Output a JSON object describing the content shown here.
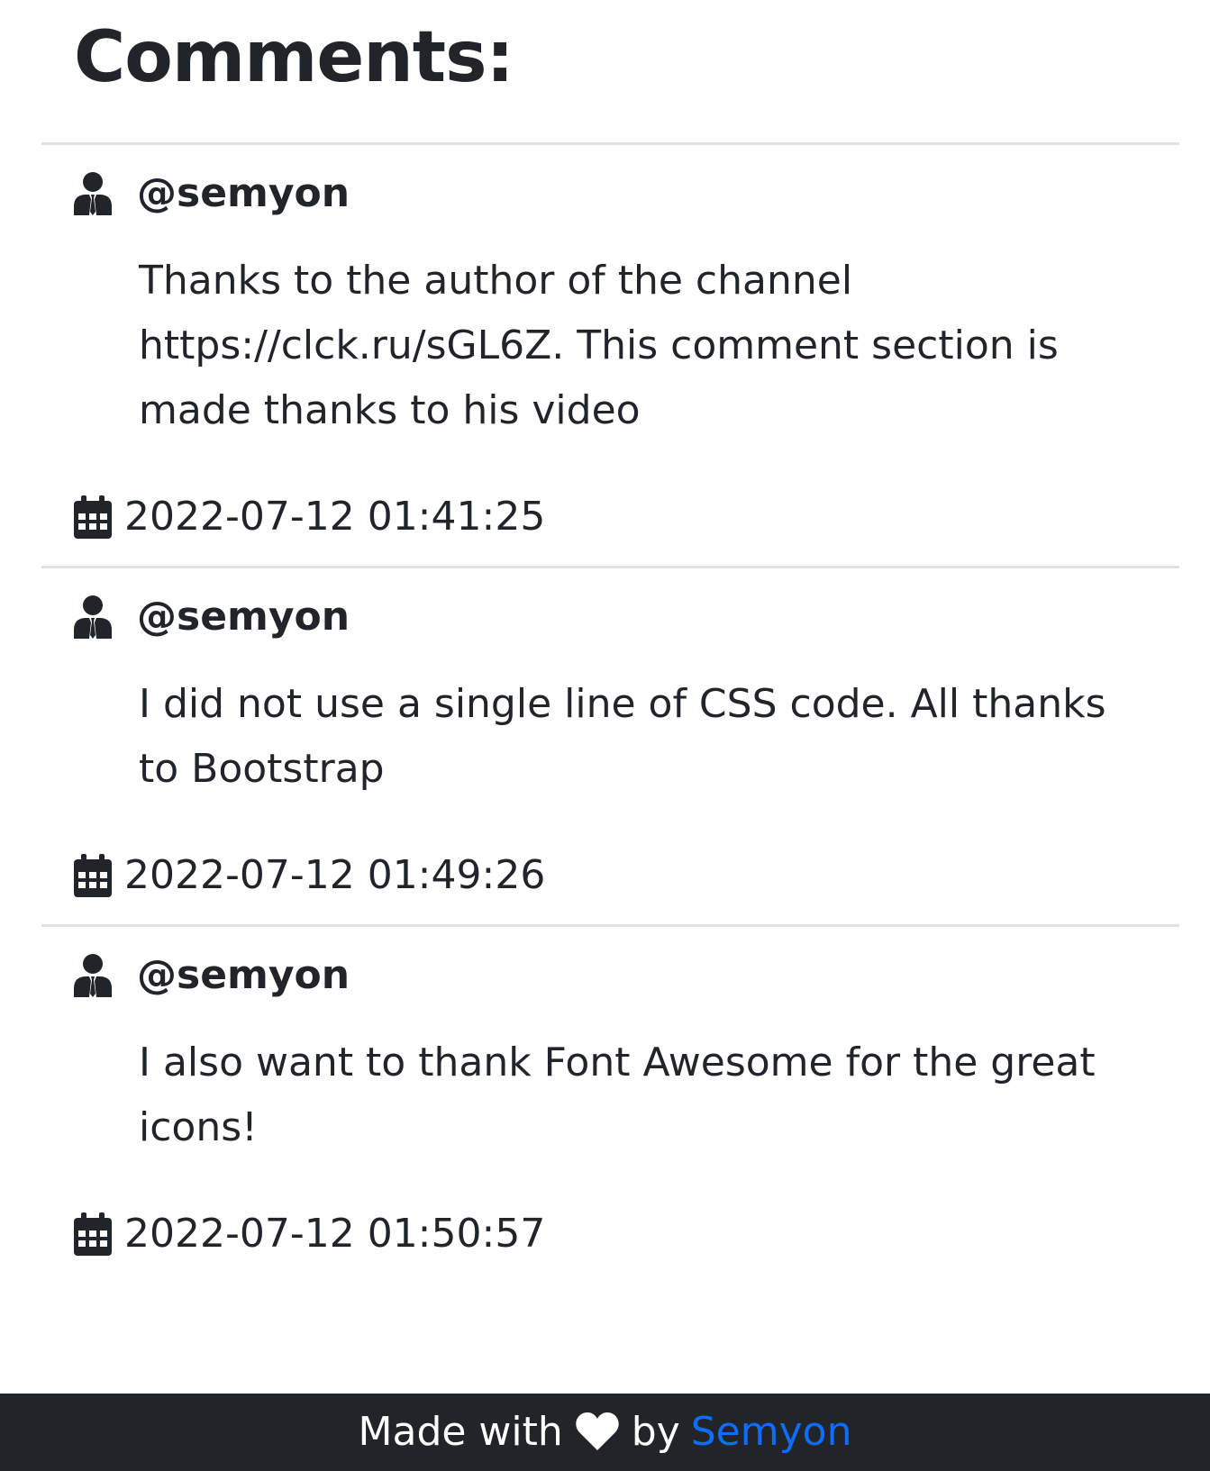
{
  "page": {
    "title": "Comments:"
  },
  "comments": [
    {
      "username": "@semyon",
      "text": "Thanks to the author of the channel https://clck.ru/sGL6Z. This comment section is made thanks to his video",
      "date": "2022-07-12 01:41:25"
    },
    {
      "username": "@semyon",
      "text": "I did not use a single line of CSS code. All thanks to Bootstrap",
      "date": "2022-07-12 01:49:26"
    },
    {
      "username": "@semyon",
      "text": "I also want to thank Font Awesome for the great icons!",
      "date": "2022-07-12 01:50:57"
    }
  ],
  "footer": {
    "prefix": "Made with",
    "by": "by",
    "author_link": "Semyon"
  },
  "icons": {
    "user": "user-tie-icon",
    "calendar": "calendar-icon",
    "heart": "heart-icon"
  },
  "colors": {
    "text": "#212529",
    "divider": "#dee2e6",
    "footer_bg": "#212529",
    "link": "#0d6efd"
  }
}
